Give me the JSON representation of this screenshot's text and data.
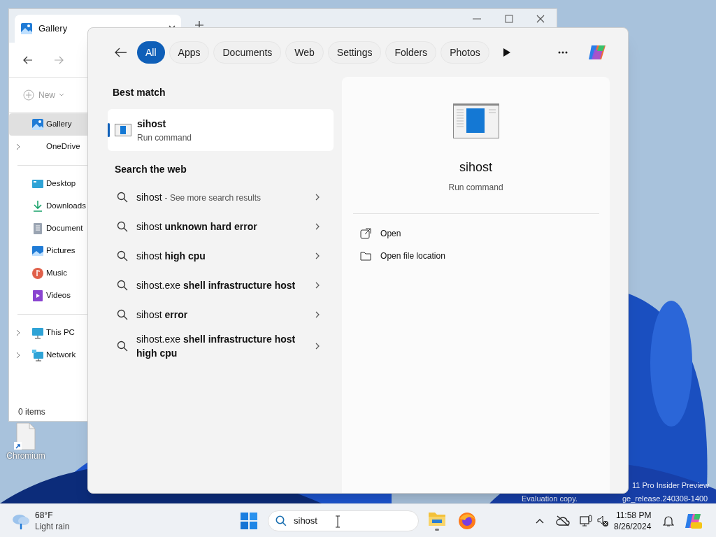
{
  "desktop": {
    "icons": [
      {
        "label": "Chromium"
      }
    ],
    "watermark": [
      "11 Pro Insider Preview",
      "Evaluation copy.",
      "ge_release.240308-1400"
    ]
  },
  "explorer": {
    "tab_title": "Gallery",
    "new_button": "New",
    "nav_groups": [
      [
        {
          "label": "Gallery",
          "kind": "gallery",
          "selected": true,
          "expandable": false
        },
        {
          "label": "OneDrive",
          "kind": "cloud",
          "selected": false,
          "expandable": true
        }
      ],
      [
        {
          "label": "Desktop",
          "kind": "desktop",
          "selected": false,
          "expandable": false
        },
        {
          "label": "Downloads",
          "kind": "download",
          "selected": false,
          "expandable": false
        },
        {
          "label": "Document",
          "kind": "document",
          "selected": false,
          "expandable": false
        },
        {
          "label": "Pictures",
          "kind": "pictures",
          "selected": false,
          "expandable": false
        },
        {
          "label": "Music",
          "kind": "music",
          "selected": false,
          "expandable": false
        },
        {
          "label": "Videos",
          "kind": "video",
          "selected": false,
          "expandable": false
        }
      ],
      [
        {
          "label": "This PC",
          "kind": "pc",
          "selected": false,
          "expandable": true
        },
        {
          "label": "Network",
          "kind": "network",
          "selected": false,
          "expandable": true
        }
      ]
    ],
    "status": "0 items"
  },
  "search_panel": {
    "filters": [
      {
        "label": "All",
        "selected": true
      },
      {
        "label": "Apps",
        "selected": false
      },
      {
        "label": "Documents",
        "selected": false
      },
      {
        "label": "Web",
        "selected": false
      },
      {
        "label": "Settings",
        "selected": false
      },
      {
        "label": "Folders",
        "selected": false
      },
      {
        "label": "Photos",
        "selected": false
      }
    ],
    "best_match_heading": "Best match",
    "best_match": {
      "title": "sihost",
      "subtitle": "Run command",
      "selected": true
    },
    "web_heading": "Search the web",
    "web_results": [
      {
        "text": "sihost",
        "suffix": "- See more search results"
      },
      {
        "text": "sihost **unknown hard error**"
      },
      {
        "text": "sihost **high cpu**"
      },
      {
        "text": "sihost.exe **shell infrastructure host**"
      },
      {
        "text": "sihost **error**"
      },
      {
        "text": "sihost.exe **shell infrastructure host high cpu**"
      }
    ],
    "preview": {
      "title": "sihost",
      "subtitle": "Run command",
      "actions": [
        {
          "label": "Open",
          "kind": "open"
        },
        {
          "label": "Open file location",
          "kind": "folder"
        }
      ]
    }
  },
  "taskbar": {
    "weather": {
      "temperature": "68°F",
      "condition": "Light rain"
    },
    "search": {
      "value": "sihost"
    },
    "time": "11:58 PM",
    "date": "8/26/2024"
  }
}
